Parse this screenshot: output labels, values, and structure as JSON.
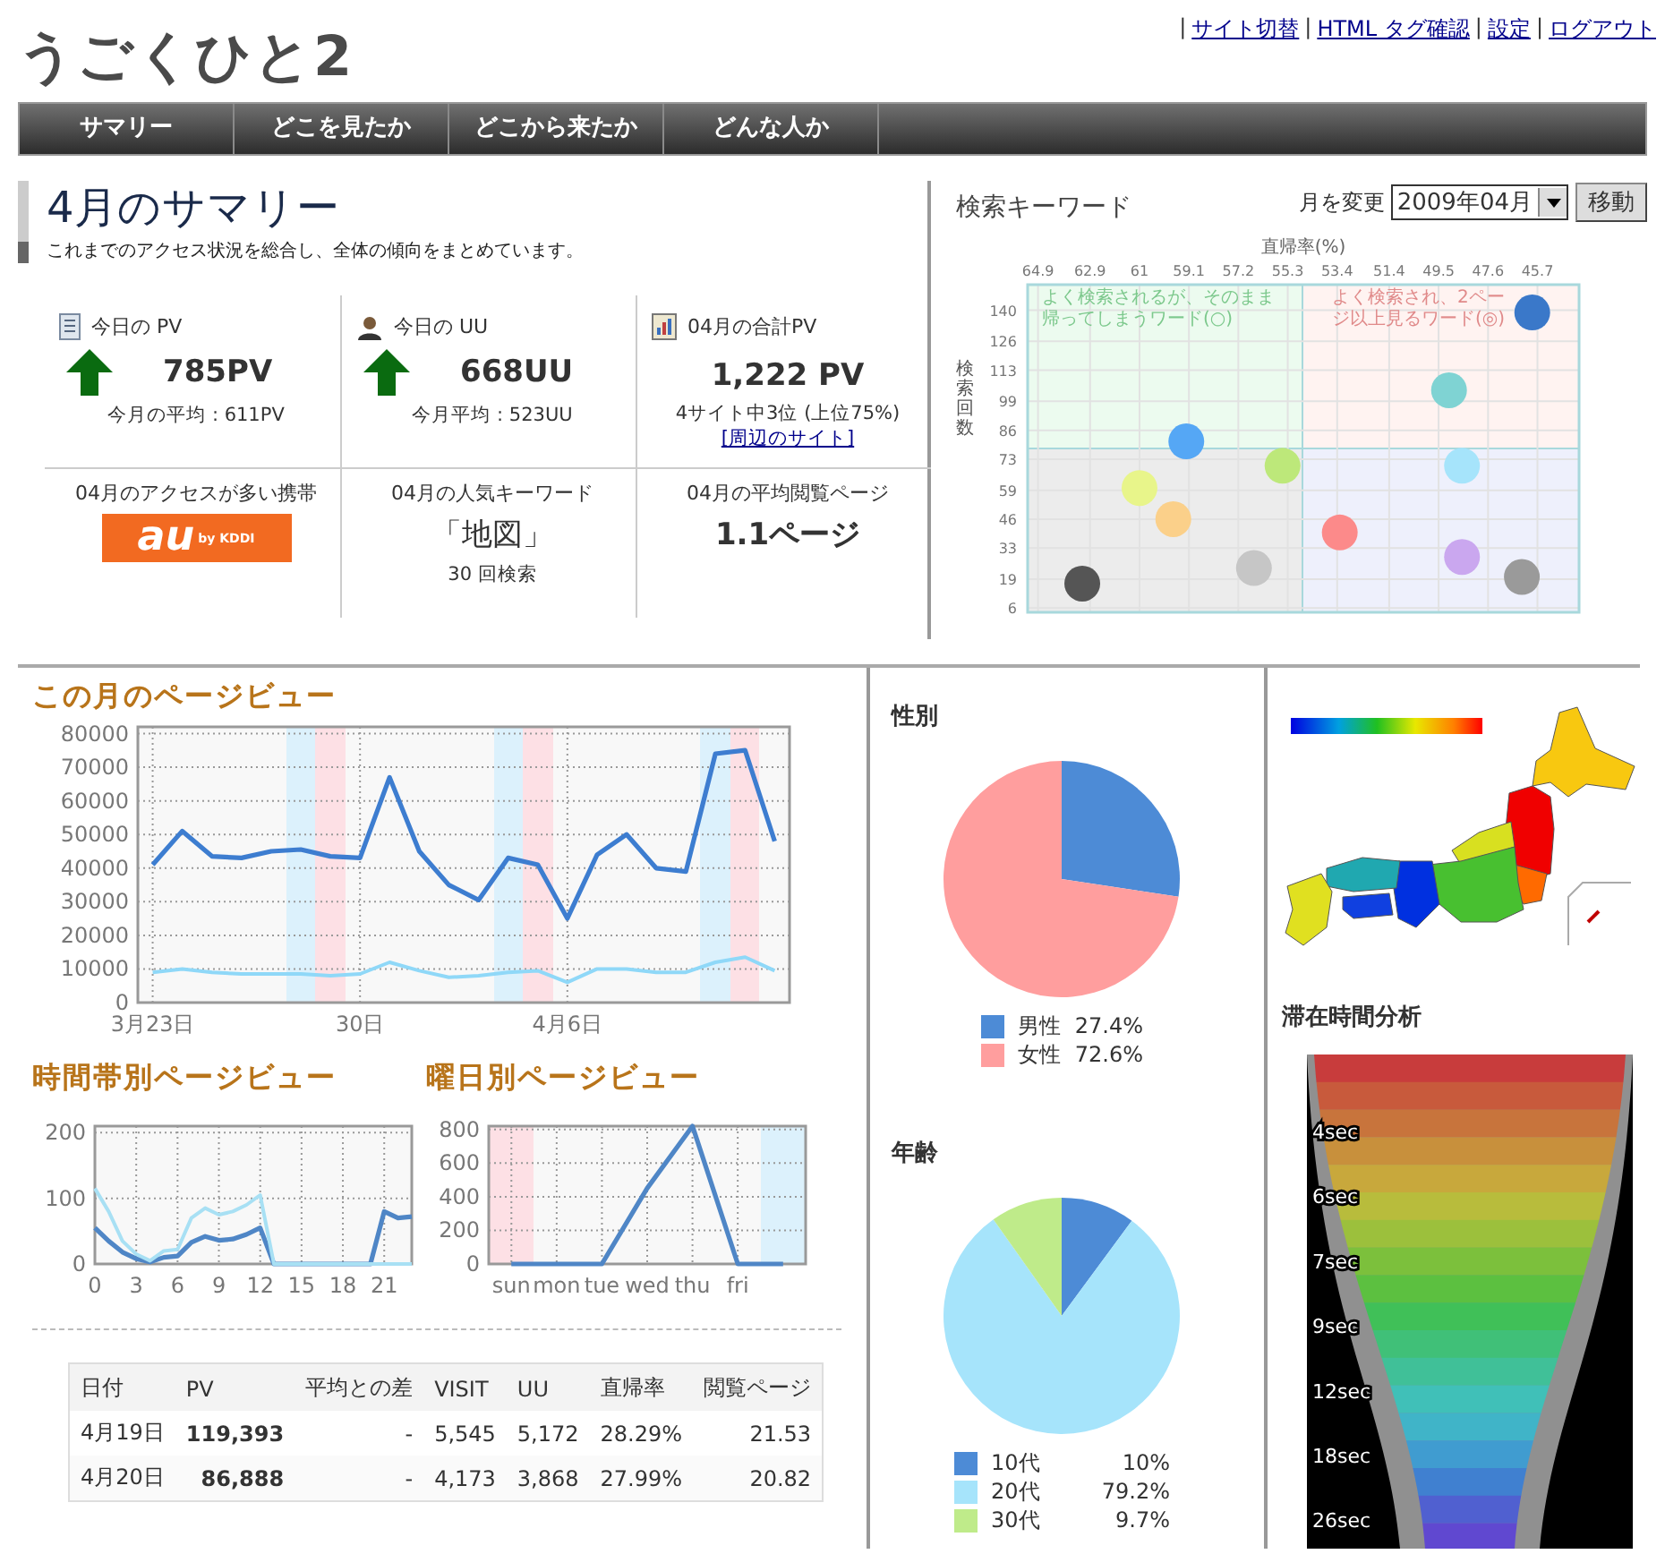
{
  "header": {
    "logo": "うごくひと2",
    "links": [
      {
        "separator": "|",
        "label": "サイト切替"
      },
      {
        "separator": "|",
        "label": "HTML タグ確認"
      },
      {
        "separator": "|",
        "label": "設定"
      },
      {
        "separator": "|",
        "label": "ログアウト"
      }
    ]
  },
  "nav": [
    "サマリー",
    "どこを見たか",
    "どこから来たか",
    "どんな人か"
  ],
  "summary": {
    "title": "4月のサマリー",
    "subtitle": "これまでのアクセス状況を総合し、全体の傾向をまとめています。",
    "stats": [
      {
        "kind": "pv",
        "label": "今日の PV",
        "rising": true,
        "value": "785PV",
        "note": "今月の平均 : 611PV"
      },
      {
        "kind": "uu",
        "label": "今日の UU",
        "rising": true,
        "value": "668UU",
        "note": "今月平均 : 523UU"
      },
      {
        "kind": "total",
        "label": "04月の合計PV",
        "value": "1,222 PV",
        "note": "4サイト中3位 (上位75%)",
        "link": "[周辺のサイト]"
      },
      {
        "kind": "carrier",
        "label": "04月のアクセスが多い携帯",
        "logo_main": "au",
        "logo_sub": "by KDDI"
      },
      {
        "kind": "keyword",
        "label": "04月の人気キーワード",
        "value": "「地図」",
        "note": "30 回検索"
      },
      {
        "kind": "pages",
        "label": "04月の平均閲覧ページ",
        "value": "1.1ページ"
      }
    ]
  },
  "keywords": {
    "month_label": "月を変更",
    "month_select": {
      "value": "2009年04月"
    },
    "move_button": "移動",
    "chart_data": {
      "type": "scatter",
      "title": "検索キーワード",
      "xlabel": "直帰率(%)",
      "ylabel": "検索回数",
      "grid": true,
      "xlim": [
        65.3,
        44.1
      ],
      "ylim": [
        4.1,
        151.5
      ],
      "xticks": [
        64.9,
        62.9,
        61,
        59.1,
        57.2,
        55.3,
        53.4,
        51.4,
        49.5,
        47.6,
        45.7
      ],
      "yticks": [
        6,
        19,
        33,
        46,
        59,
        73,
        86,
        99,
        113,
        126,
        140
      ],
      "x": [
        45.9,
        49.1,
        59.2,
        55.5,
        48.6,
        61,
        59.7,
        56.6,
        53.3,
        48.6,
        46.3,
        63.2
      ],
      "series": [
        {
          "values": [
            139,
            104,
            81,
            70,
            70,
            60,
            46,
            24,
            40,
            29,
            20,
            17
          ]
        }
      ],
      "colors": [
        "#3a78c9",
        "#7fd3d3",
        "#55a7f5",
        "#bde87a",
        "#a6e4fb",
        "#e8f58a",
        "#fbd08a",
        "#c6c6c6",
        "#fc8a8a",
        "#caa7ef",
        "#9a9a9a",
        "#555555"
      ],
      "annotations": [
        {
          "text": "よく検索されるが、そのまま帰ってしまうワード(○)"
        },
        {
          "text": "よく検索され、2ページ以上見るワード(◎)"
        }
      ]
    }
  },
  "pageviews": {
    "chart_data": {
      "type": "line",
      "title": "この月のページビュー",
      "grid": true,
      "categories": [
        "3月23日",
        null,
        null,
        null,
        null,
        null,
        null,
        "30日",
        null,
        null,
        null,
        null,
        null,
        null,
        "4月6日",
        null,
        null,
        null,
        null,
        null,
        null,
        null
      ],
      "ylim": [
        0,
        82000
      ],
      "yticks": [
        0,
        10000,
        20000,
        30000,
        40000,
        50000,
        60000,
        70000,
        80000
      ],
      "series": [
        {
          "color": "#3d7dd0",
          "values": [
            41000,
            51000,
            43500,
            43000,
            45000,
            45500,
            43500,
            43000,
            67000,
            45000,
            35000,
            30500,
            43000,
            41000,
            25000,
            44000,
            50000,
            40000,
            39000,
            74000,
            75000,
            48000
          ]
        },
        {
          "color": "#8fd8f8",
          "values": [
            9000,
            10000,
            9000,
            8500,
            8500,
            8500,
            8000,
            8500,
            12000,
            9500,
            7500,
            8000,
            9000,
            9500,
            6000,
            10000,
            10000,
            9000,
            9000,
            12000,
            13500,
            9500
          ]
        }
      ]
    }
  },
  "hourly": {
    "chart_data": {
      "type": "line",
      "title": "時間帯別ページビュー",
      "grid": true,
      "x": [
        0,
        1,
        2,
        3,
        4,
        5,
        6,
        7,
        8,
        9,
        10,
        11,
        12,
        13,
        14,
        15,
        16,
        17,
        18,
        19,
        20,
        21,
        22,
        23
      ],
      "xlim": [
        0,
        23
      ],
      "ylim": [
        0,
        210
      ],
      "xticks": [
        0,
        3,
        6,
        9,
        12,
        15,
        18,
        21
      ],
      "yticks": [
        0,
        100,
        200
      ],
      "series": [
        {
          "color": "#4f86c6",
          "values": [
            55,
            35,
            18,
            8,
            3,
            10,
            12,
            33,
            42,
            36,
            38,
            45,
            55,
            0,
            0,
            0,
            0,
            0,
            0,
            0,
            0,
            80,
            70,
            72
          ]
        },
        {
          "color": "#a8e0f4",
          "values": [
            115,
            80,
            35,
            15,
            5,
            20,
            22,
            70,
            85,
            75,
            80,
            90,
            105,
            0,
            0,
            0,
            0,
            0,
            0,
            0,
            0,
            0,
            0,
            0
          ]
        }
      ]
    }
  },
  "weekday": {
    "chart_data": {
      "type": "line",
      "title": "曜日別ページビュー",
      "grid": true,
      "categories": [
        "sun",
        "mon",
        "tue",
        "wed",
        "thu",
        "fri",
        null
      ],
      "ylim": [
        0,
        820
      ],
      "yticks": [
        0,
        200,
        400,
        600,
        800
      ],
      "series": [
        {
          "color": "#4f86c6",
          "values": [
            0,
            0,
            0,
            450,
            820,
            0,
            0
          ]
        }
      ]
    }
  },
  "table": {
    "columns": [
      "日付",
      "PV",
      "平均との差",
      "VISIT",
      "UU",
      "直帰率",
      "閲覧ページ"
    ],
    "rows": [
      [
        "4月19日",
        "119,393",
        "-",
        "5,545",
        "5,172",
        "28.29%",
        "21.53"
      ],
      [
        "4月20日",
        "86,888",
        "-",
        "4,173",
        "3,868",
        "27.99%",
        "20.82"
      ]
    ]
  },
  "gender": {
    "chart_data": {
      "type": "pie",
      "title": "性別",
      "legend": "bottom",
      "categories": [
        "男性",
        "女性"
      ],
      "values": [
        27.4,
        72.6
      ],
      "colors": [
        "#4d8bd6",
        "#ff9e9e"
      ],
      "value_labels": [
        "27.4%",
        "72.6%"
      ]
    }
  },
  "age": {
    "chart_data": {
      "type": "pie",
      "title": "年齢",
      "legend": "bottom",
      "categories": [
        "10代",
        "20代",
        "30代"
      ],
      "values": [
        10,
        79.2,
        9.7
      ],
      "colors": [
        "#4d8bd6",
        "#a6e4fb",
        "#bfeb8a"
      ],
      "value_labels": [
        "10%",
        "79.2%",
        "9.7%"
      ]
    }
  },
  "dwell_time": {
    "title": "滞在時間分析",
    "labels": [
      "4sec",
      "6sec",
      "7sec",
      "9sec",
      "12sec",
      "18sec",
      "26sec"
    ]
  }
}
